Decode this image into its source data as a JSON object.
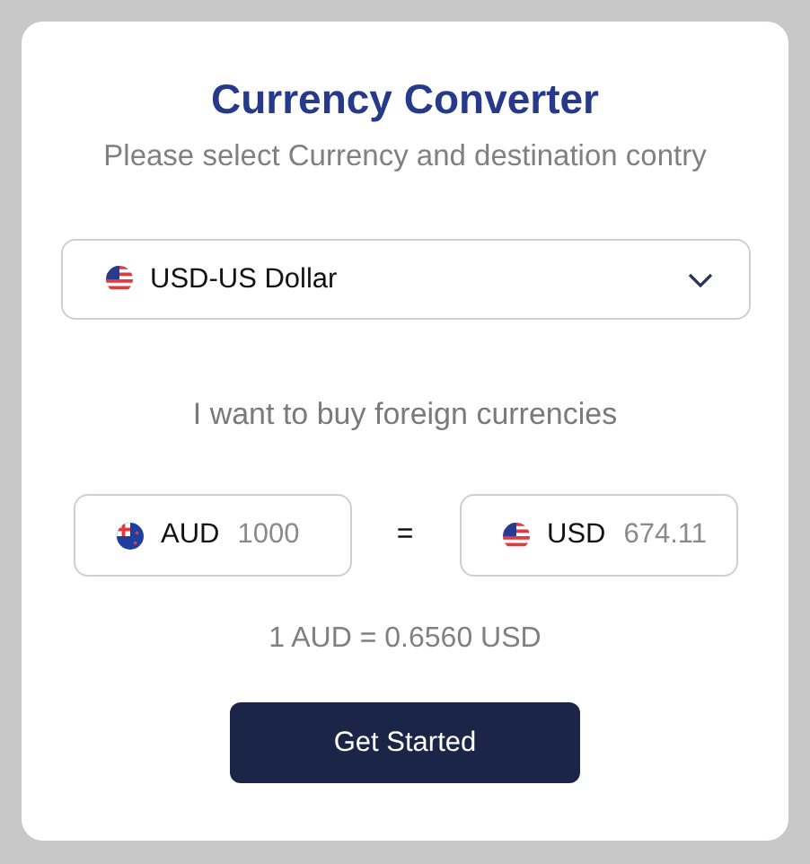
{
  "title": "Currency Converter",
  "subtitle": "Please select Currency and destination contry",
  "dropdown": {
    "value": "USD-US Dollar",
    "kind": "us"
  },
  "prompt": "I want to buy foreign currencies",
  "converter": {
    "from": {
      "currency": "AUD",
      "amount": "1000",
      "kind": "au"
    },
    "equals": "=",
    "to": {
      "currency": "USD",
      "amount": "674.11",
      "kind": "us"
    }
  },
  "rate": "1 AUD = 0.6560 USD",
  "button": "Get Started"
}
